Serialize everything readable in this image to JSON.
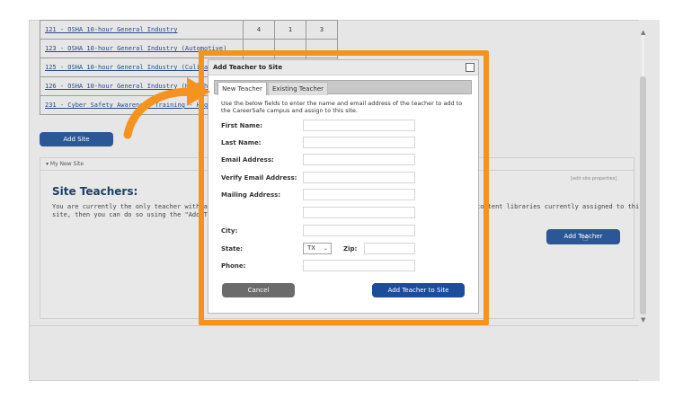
{
  "course_table": {
    "rows": [
      {
        "name": "121 - OSHA 10-hour General Industry",
        "c1": "4",
        "c2": "1",
        "c3": "3"
      },
      {
        "name": "123 - OSHA 10-hour General Industry (Automotive)",
        "c1": "",
        "c2": "",
        "c3": ""
      },
      {
        "name": "125 - OSHA 10-hour General Industry (Culinary)",
        "c1": "",
        "c2": "",
        "c3": ""
      },
      {
        "name": "126 - OSHA 10-hour General Industry (Healthcare)",
        "c1": "",
        "c2": "",
        "c3": ""
      },
      {
        "name": "231 - Cyber Safety Awareness Training - High School",
        "c1": "",
        "c2": "",
        "c3": ""
      }
    ]
  },
  "add_site_label": "Add Site",
  "site_panel": {
    "header": "▾ My New Site",
    "edit_link": "[edit site properties]",
    "title": "Site Teachers:",
    "desc_line1": "You are currently the only teacher with access to",
    "desc_line2": "site, then you can do so using the \"Add Teacher\"",
    "desc_right": "content libraries currently assigned to this",
    "add_teacher_label": "Add Teacher"
  },
  "dialog": {
    "title": "Add Teacher to Site",
    "tabs": [
      "New Teacher",
      "Existing Teacher"
    ],
    "intro": "Use the below fields to enter the name and email address of the teacher to add to the CareerSafe campus and assign to this site.",
    "labels": {
      "first_name": "First Name:",
      "last_name": "Last Name:",
      "email": "Email Address:",
      "verify_email": "Verify Email Address:",
      "mailing": "Mailing Address:",
      "city": "City:",
      "state": "State:",
      "zip": "Zip:",
      "phone": "Phone:"
    },
    "state_value": "TX",
    "cancel_label": "Cancel",
    "submit_label": "Add Teacher to Site"
  },
  "colors": {
    "highlight": "#f5931e",
    "primary_button": "#1b4d9a",
    "cancel_button": "#6b6b6b"
  }
}
